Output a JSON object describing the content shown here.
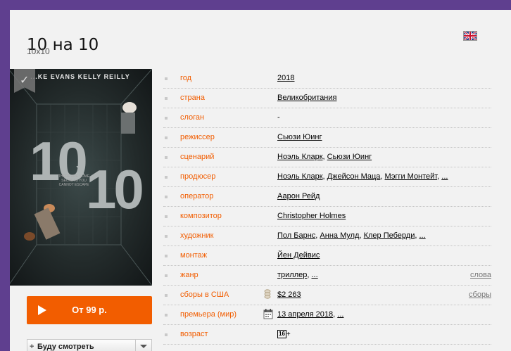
{
  "film": {
    "title": "10 на 10",
    "original_title": "10x10"
  },
  "poster": {
    "names": "...KE EVANS    KELLY REILLY",
    "big_left": "10",
    "big_x": "x",
    "big_right": "10",
    "tagline": "THERE ARE SOME SECRETS YOU CANNOT ESCAPE"
  },
  "buttons": {
    "watch_label": "От 99 р.",
    "later_label": "Буду смотреть",
    "later_plus": "+"
  },
  "info": {
    "year": {
      "key": "год",
      "value": "2018"
    },
    "country": {
      "key": "страна",
      "value": "Великобритания"
    },
    "slogan": {
      "key": "слоган",
      "value": "-"
    },
    "director": {
      "key": "режиссер",
      "value": "Сьюзи Юинг"
    },
    "writer": {
      "key": "сценарий",
      "values": [
        "Ноэль Кларк",
        "Сьюзи Юинг"
      ]
    },
    "producer": {
      "key": "продюсер",
      "values": [
        "Ноэль Кларк",
        "Джейсон Маца",
        "Мэгги Монтейт"
      ],
      "more": "..."
    },
    "operator": {
      "key": "оператор",
      "value": "Аарон Рейд"
    },
    "composer": {
      "key": "композитор",
      "value": "Christopher Holmes"
    },
    "artist": {
      "key": "художник",
      "values": [
        "Пол Барнс",
        "Анна Мулд",
        "Клер Пеберди"
      ],
      "more": "..."
    },
    "editing": {
      "key": "монтаж",
      "value": "Йен Дейвис"
    },
    "genre": {
      "key": "жанр",
      "value": "триллер",
      "more": "...",
      "extra": "слова"
    },
    "box_office": {
      "key": "сборы в США",
      "value": "$2 263",
      "extra": "сборы"
    },
    "premiere": {
      "key": "премьера (мир)",
      "value": "13 апреля 2018",
      "more": "..."
    },
    "age": {
      "key": "возраст",
      "value": "16",
      "suffix": "+"
    }
  },
  "colors": {
    "accent": "#f25d00",
    "frame": "#5f3f8f",
    "background": "#f2f2f2"
  },
  "icons": [
    "uk-flag-icon",
    "bookmark-icon",
    "play-icon",
    "coins-icon",
    "calendar-icon",
    "chevron-down-icon"
  ]
}
